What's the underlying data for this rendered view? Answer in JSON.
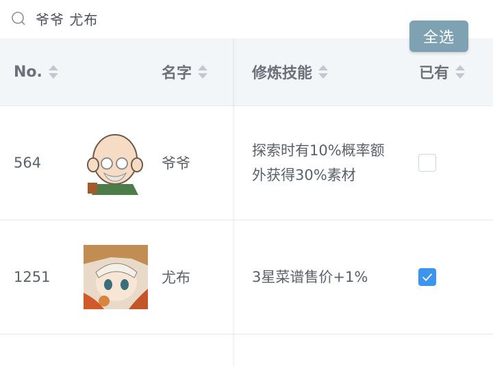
{
  "search": {
    "query": "爷爷 尤布"
  },
  "toolbar": {
    "select_all_label": "全选"
  },
  "table": {
    "headers": {
      "no": "No.",
      "name": "名字",
      "skill": "修炼技能",
      "owned": "已有"
    },
    "rows": [
      {
        "no": "564",
        "name": "爷爷",
        "skill": "探索时有10%概率额外获得30%素材",
        "owned": false,
        "avatar_icon": "grandpa-avatar-icon"
      },
      {
        "no": "1251",
        "name": "尤布",
        "skill": "3星菜谱售价+1%",
        "owned": true,
        "avatar_icon": "youbu-avatar-icon"
      }
    ]
  },
  "colors": {
    "accent": "#3b94ee",
    "select_all_bg": "#7fa2b2",
    "header_bg": "#f3f6f9",
    "text": "#5b6069"
  }
}
